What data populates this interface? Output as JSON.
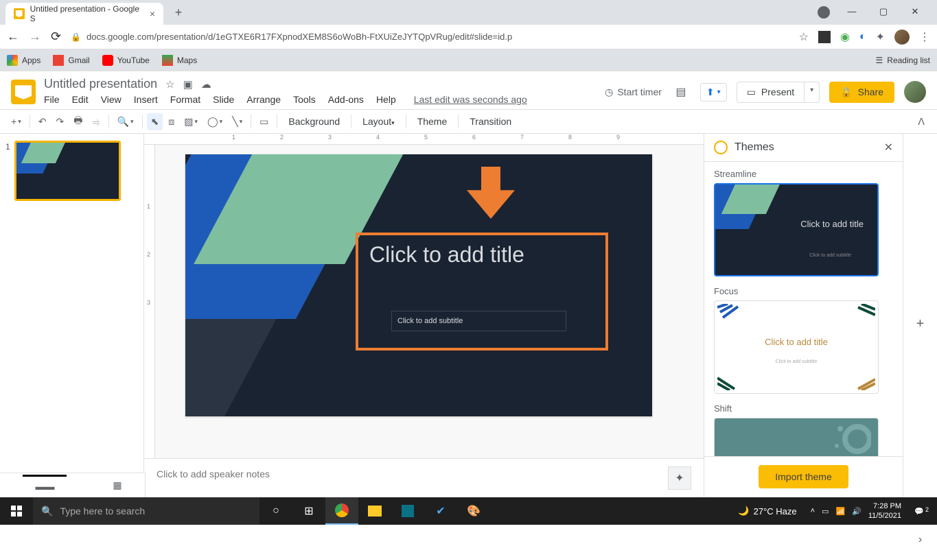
{
  "browser": {
    "tab_title": "Untitled presentation - Google S",
    "url": "docs.google.com/presentation/d/1eGTXE6R17FXpnodXEM8S6oWoBh-FtXUiZeJYTQpVRug/edit#slide=id.p",
    "bookmarks": [
      "Apps",
      "Gmail",
      "YouTube",
      "Maps"
    ],
    "reading_list": "Reading list"
  },
  "doc": {
    "title": "Untitled presentation",
    "status": "Last edit was seconds ago",
    "menus": [
      "File",
      "Edit",
      "View",
      "Insert",
      "Format",
      "Slide",
      "Arrange",
      "Tools",
      "Add-ons",
      "Help"
    ]
  },
  "header": {
    "timer": "Start timer",
    "present": "Present",
    "share": "Share"
  },
  "toolbar": {
    "background": "Background",
    "layout": "Layout",
    "theme": "Theme",
    "transition": "Transition"
  },
  "slide": {
    "title_placeholder": "Click to add title",
    "subtitle_placeholder": "Click to add subtitle",
    "notes_placeholder": "Click to add speaker notes"
  },
  "themes": {
    "panel_title": "Themes",
    "items": [
      {
        "name": "Streamline",
        "title": "Click to add title",
        "sub": "Click to add subtitle"
      },
      {
        "name": "Focus",
        "title": "Click to add title",
        "sub": "Click to add subtitle"
      },
      {
        "name": "Shift"
      }
    ],
    "import": "Import theme"
  },
  "ruler": {
    "h": [
      "1",
      "2",
      "3",
      "4",
      "5",
      "6",
      "7",
      "8",
      "9"
    ],
    "v": [
      "1",
      "2",
      "3"
    ]
  },
  "filmstrip": {
    "num": "1"
  },
  "taskbar": {
    "search_placeholder": "Type here to search",
    "weather": "27°C Haze",
    "time": "7:28 PM",
    "date": "11/5/2021",
    "notif_count": "2"
  }
}
